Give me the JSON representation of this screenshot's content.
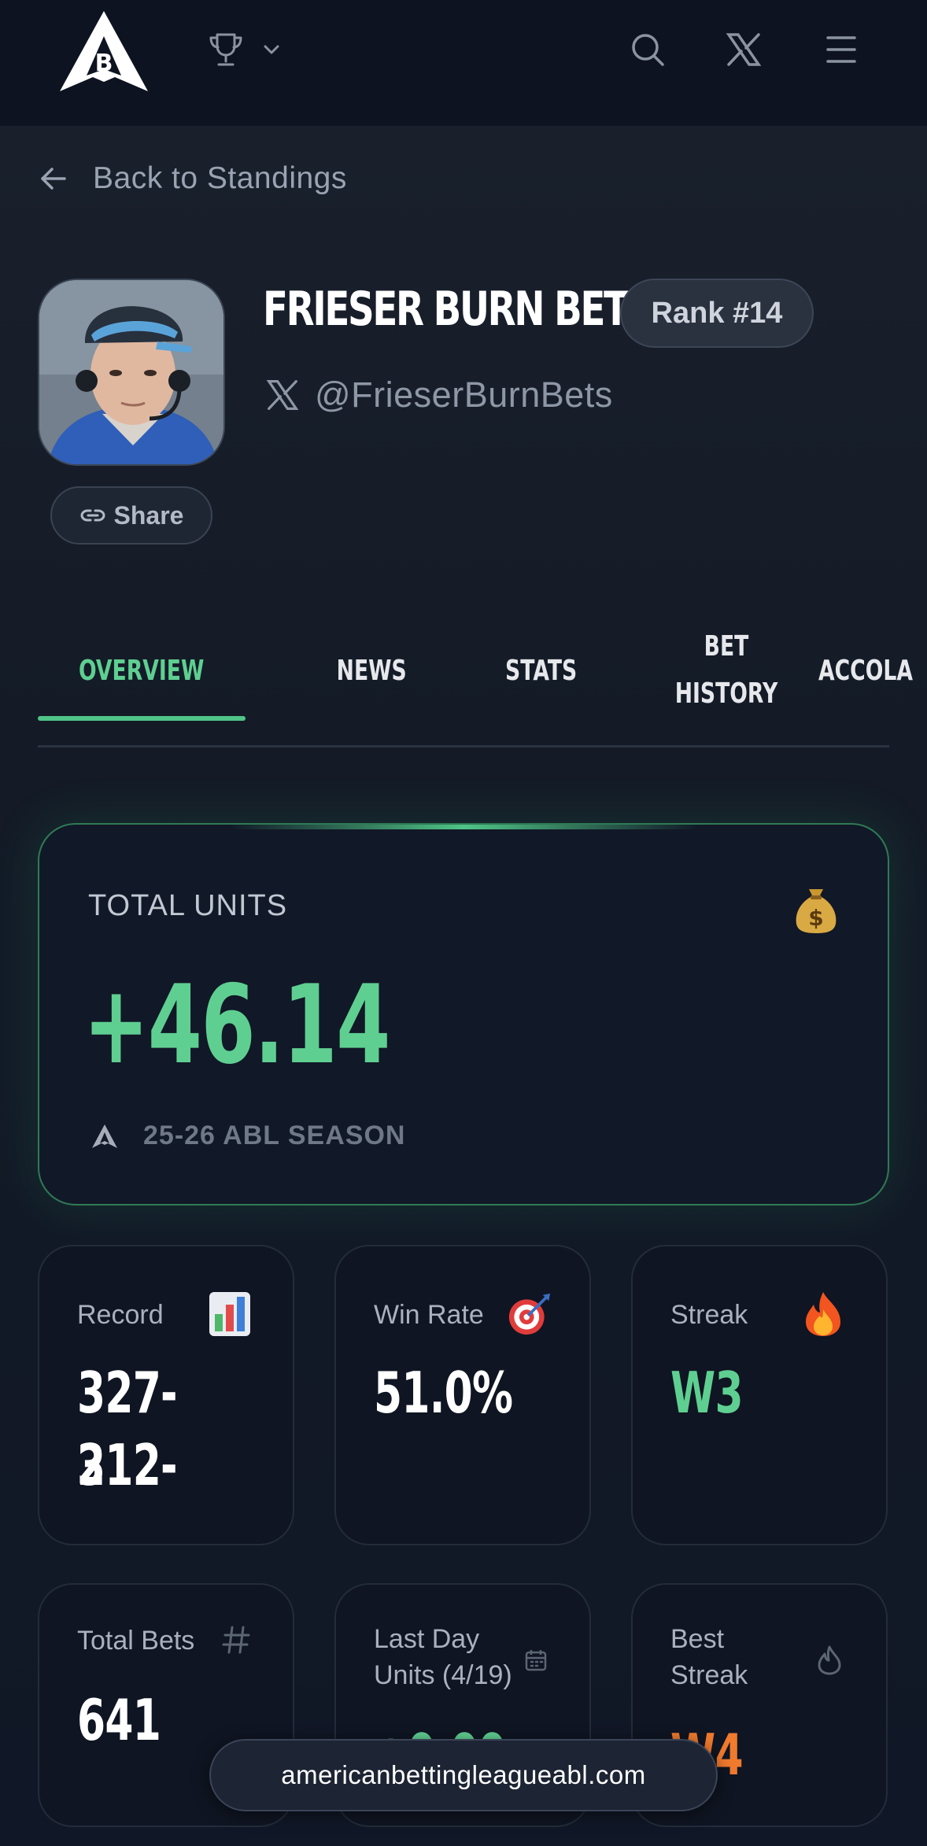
{
  "header": {
    "logo_letter": "B",
    "icons": [
      "logo-icon",
      "trophy-icon",
      "chevron-down-icon",
      "search-icon",
      "x-logo-icon",
      "menu-icon"
    ]
  },
  "back_link": {
    "label": "Back to Standings"
  },
  "profile": {
    "name": "FRIESER BURN BETS",
    "rank": "Rank #14",
    "handle": "@FrieserBurnBets",
    "share_label": "Share"
  },
  "tabs": [
    {
      "label": "OVERVIEW",
      "active": true
    },
    {
      "label": "NEWS",
      "active": false
    },
    {
      "label": "STATS",
      "active": false
    },
    {
      "label": "BET HISTORY",
      "active": false
    },
    {
      "label": "ACCOLA",
      "active": false
    }
  ],
  "total_units": {
    "label": "TOTAL UNITS",
    "value": "+46.14",
    "season": "25-26 ABL SEASON",
    "icon": "money-bag-icon"
  },
  "stats": [
    {
      "label": "Record",
      "value": "327-312-2",
      "value_line1": "327-312-",
      "value_line2": "2",
      "icon": "bar-chart-icon"
    },
    {
      "label": "Win Rate",
      "value": "51.0%",
      "icon": "target-icon"
    },
    {
      "label": "Streak",
      "value": "W3",
      "icon": "fire-icon"
    },
    {
      "label": "Total Bets",
      "value": "641",
      "icon": "hash-icon"
    },
    {
      "label_line1": "Last Day",
      "label_line2": "Units (4/19)",
      "value": "+0.00",
      "icon": "calendar-icon"
    },
    {
      "label_line1": "Best",
      "label_line2": "Streak",
      "value": "W4",
      "icon": "flame-icon"
    }
  ],
  "url_bar": {
    "text": "americanbettingleagueabl.com"
  },
  "colors": {
    "accent_green": "#5fcf91",
    "streak_orange": "#f07a2e",
    "background": "#111827"
  }
}
